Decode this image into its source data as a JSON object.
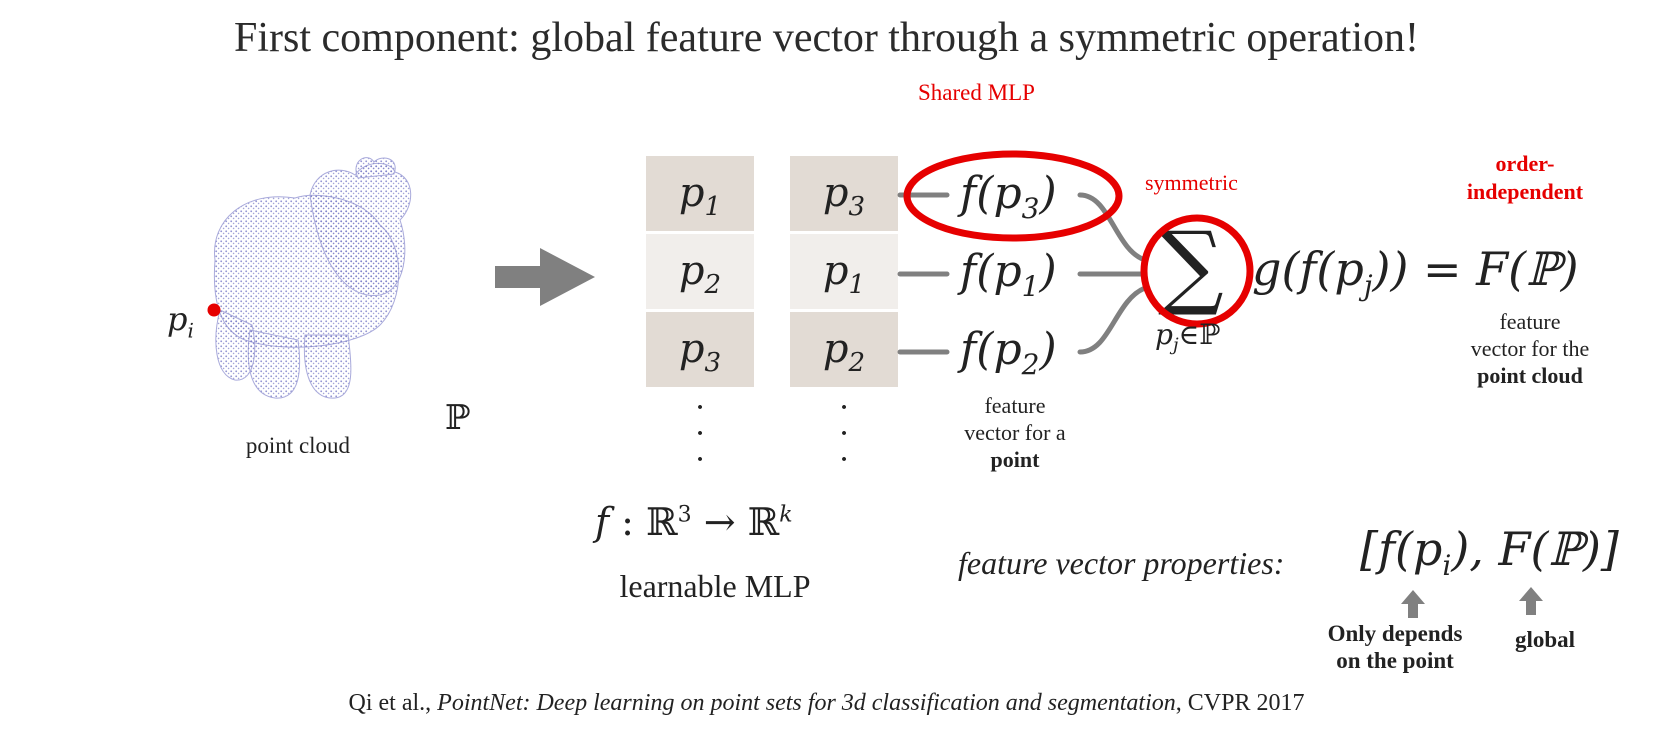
{
  "title": "First component: global feature vector through a symmetric operation!",
  "labels": {
    "shared_mlp": "Shared MLP",
    "symmetric": "symmetric",
    "order_independent_1": "order-",
    "order_independent_2": "independent",
    "point_cloud": "point cloud",
    "point_symbol": "p",
    "point_subscript": "i",
    "set_symbol": "ℙ"
  },
  "table_left": [
    "p1",
    "p2",
    "p3"
  ],
  "table_right": [
    "p3",
    "p1",
    "p2"
  ],
  "table_left_display": [
    {
      "base": "p",
      "sub": "1"
    },
    {
      "base": "p",
      "sub": "2"
    },
    {
      "base": "p",
      "sub": "3"
    }
  ],
  "table_right_display": [
    {
      "base": "p",
      "sub": "3"
    },
    {
      "base": "p",
      "sub": "1"
    },
    {
      "base": "p",
      "sub": "2"
    }
  ],
  "features": [
    {
      "text": "f(p",
      "sub": "3",
      "close": ")"
    },
    {
      "text": "f(p",
      "sub": "1",
      "close": ")"
    },
    {
      "text": "f(p",
      "sub": "2",
      "close": ")"
    }
  ],
  "feature_point_caption": {
    "line1": "feature",
    "line2": "vector for a",
    "line3": "point"
  },
  "aggregation": {
    "sum_symbol": "∑",
    "sum_subscript": "p",
    "sum_subscript_j": "j",
    "sum_subscript_rest": "∈ℙ",
    "expression": "g(f(p",
    "expression_sub": "j",
    "expression_close": ")) = F(ℙ)"
  },
  "feature_cloud_caption": {
    "line1": "feature",
    "line2": "vector for the",
    "line3": "point cloud"
  },
  "mlp": {
    "formula_f": "f",
    "formula_rest": " : ℝ",
    "formula_sup3": "3",
    "formula_arrow": " → ℝ",
    "formula_supk": "k",
    "label": "learnable MLP"
  },
  "properties": {
    "label": "feature vector properties:",
    "vector_open": "[f(p",
    "vector_sub": "i",
    "vector_mid": "), F(ℙ)]",
    "arrow1_label_line1": "Only depends",
    "arrow1_label_line2": "on  the point",
    "arrow2_label": "global"
  },
  "citation": {
    "authors": "Qi et al., ",
    "paper": "PointNet: Deep learning on point sets for 3d classification and segmentation",
    "venue": ", CVPR 2017"
  },
  "colors": {
    "accent_red": "#e60000",
    "cell_dark": "#e2dbd4",
    "cell_light": "#f1eeeb",
    "connector_gray": "#808080",
    "point_cloud": "#7d7fc8"
  }
}
